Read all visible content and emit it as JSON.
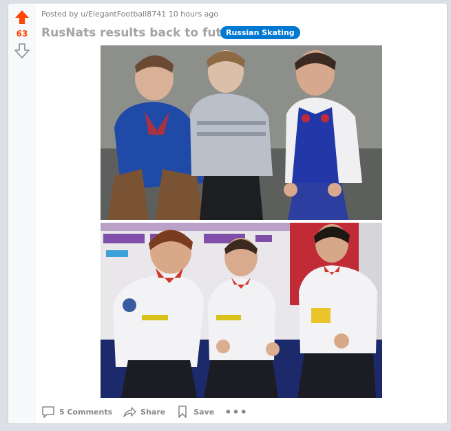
{
  "post": {
    "score": "63",
    "meta_prefix": "Posted by",
    "author": "u/ElegantFootball8741",
    "time": "10 hours ago",
    "title": "RusNats results back to future",
    "flair": "Russian Skating"
  },
  "actions": {
    "comments": "5 Comments",
    "share": "Share",
    "save": "Save",
    "more": "•••"
  },
  "colors": {
    "upvote": "#ff4500",
    "flair_bg": "#0079d3"
  }
}
